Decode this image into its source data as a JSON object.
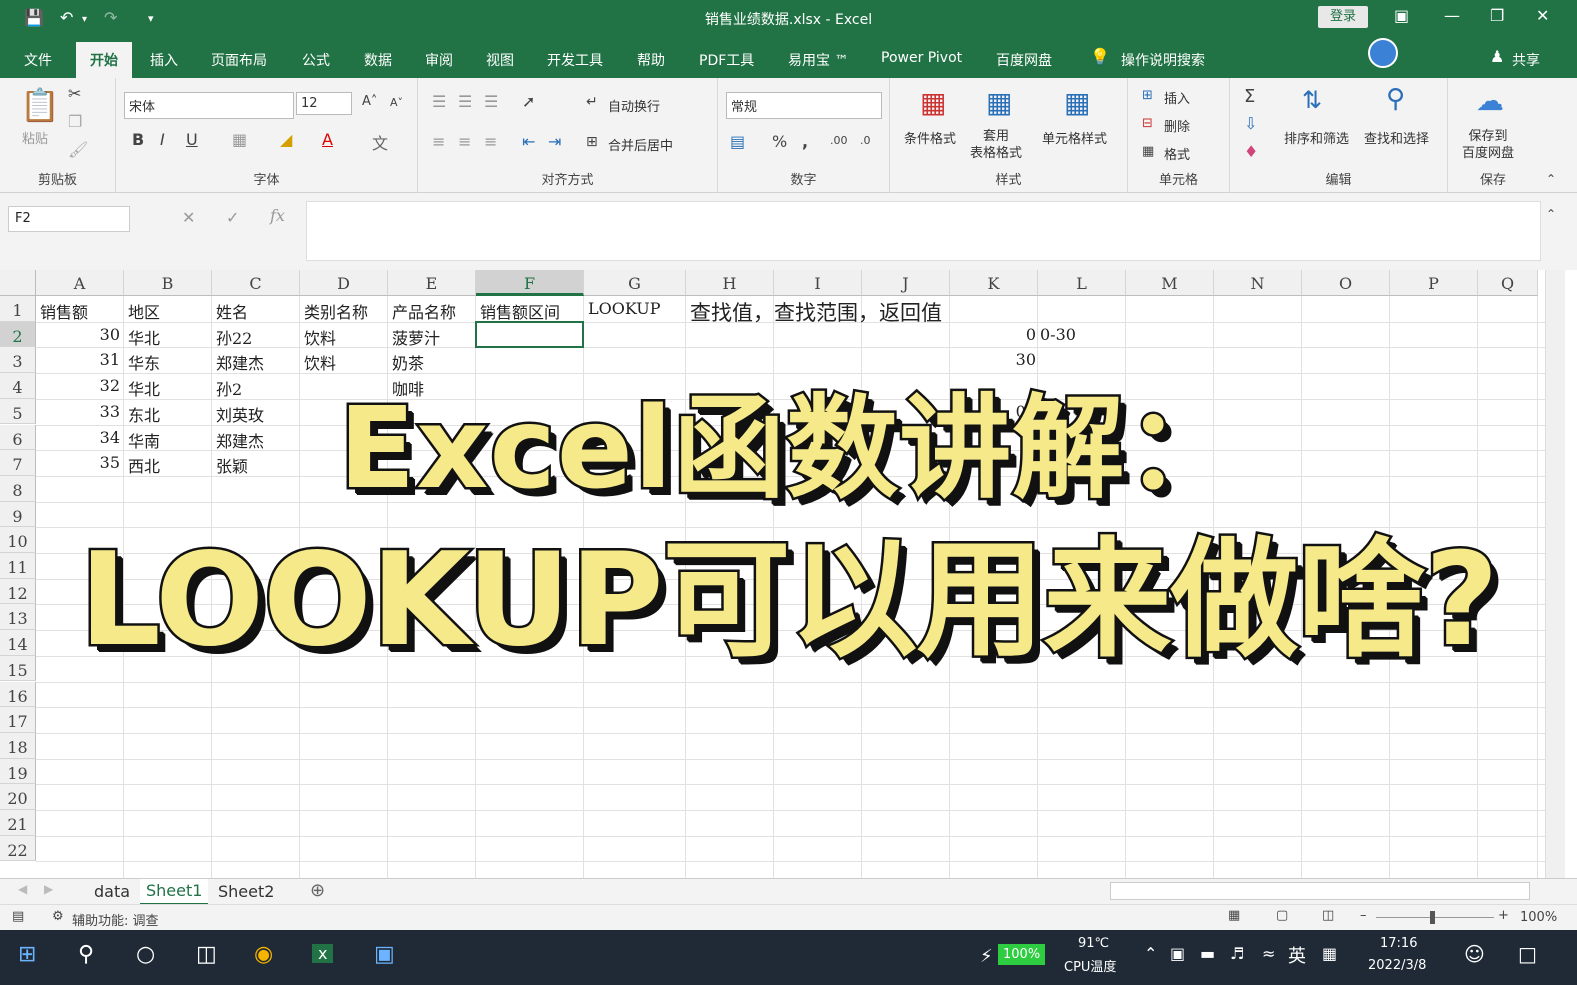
{
  "window": {
    "title": "销售业绩数据.xlsx  -  Excel",
    "login": "登录"
  },
  "tabs": [
    "文件",
    "开始",
    "插入",
    "页面布局",
    "公式",
    "数据",
    "审阅",
    "视图",
    "开发工具",
    "帮助",
    "PDF工具",
    "易用宝 ™",
    "Power Pivot",
    "百度网盘"
  ],
  "tell_me": "操作说明搜索",
  "share": "共享",
  "ribbon": {
    "clipboard": {
      "label": "剪贴板",
      "paste": "粘贴"
    },
    "font": {
      "label": "字体",
      "name": "宋体",
      "size": "12"
    },
    "alignment": {
      "label": "对齐方式",
      "wrap": "自动换行",
      "merge": "合并后居中"
    },
    "number": {
      "label": "数字",
      "format": "常规"
    },
    "styles": {
      "label": "样式",
      "cond": "条件格式",
      "table": "套用\n表格格式",
      "cell": "单元格样式"
    },
    "cells": {
      "label": "单元格",
      "insert": "插入",
      "delete": "删除",
      "format": "格式"
    },
    "editing": {
      "label": "编辑",
      "sort": "排序和筛选",
      "find": "查找和选择"
    },
    "save": {
      "label": "保存",
      "save_baidu": "保存到\n百度网盘"
    }
  },
  "formula_bar": {
    "name_box": "F2",
    "formula": ""
  },
  "grid": {
    "columns": [
      "A",
      "B",
      "C",
      "D",
      "E",
      "F",
      "G",
      "H",
      "I",
      "J",
      "K",
      "L",
      "M",
      "N",
      "O",
      "P",
      "Q"
    ],
    "selected_column": "F",
    "rows": [
      "1",
      "2",
      "3",
      "4",
      "5",
      "6",
      "7",
      "8",
      "9",
      "10",
      "11",
      "12",
      "13",
      "14",
      "15",
      "16",
      "17",
      "18",
      "19",
      "20",
      "21",
      "22"
    ],
    "selected_row": "2",
    "header_row": [
      "销售额",
      "地区",
      "姓名",
      "类别名称",
      "产品名称",
      "销售额区间",
      "LOOKUP"
    ],
    "note": "查找值，查找范围，返回值",
    "data": [
      [
        "30",
        "华北",
        "孙22",
        "饮料",
        "菠萝汁"
      ],
      [
        "31",
        "华东",
        "郑建杰",
        "饮料",
        "奶茶"
      ],
      [
        "32",
        "华北",
        "孙2",
        "",
        "咖啡"
      ],
      [
        "33",
        "东北",
        "刘英玫",
        "",
        ""
      ],
      [
        "34",
        "华南",
        "郑建杰",
        "",
        ""
      ],
      [
        "35",
        "西北",
        "张颖",
        "",
        ""
      ]
    ],
    "k_values": [
      "0",
      "30",
      "",
      "00"
    ],
    "l_values": [
      "0-30"
    ]
  },
  "sheets": [
    "data",
    "Sheet1",
    "Sheet2"
  ],
  "active_sheet": "Sheet1",
  "status": {
    "accessibility": "辅助功能: 调查",
    "zoom": "100%"
  },
  "taskbar": {
    "battery": "100%",
    "temp": "91℃",
    "temp_label": "CPU温度",
    "ime": "英",
    "time": "17:16",
    "date": "2022/3/8"
  },
  "overlay": {
    "line1": "Excel函数讲解：",
    "line2": "LOOKUP可以用来做啥?"
  }
}
